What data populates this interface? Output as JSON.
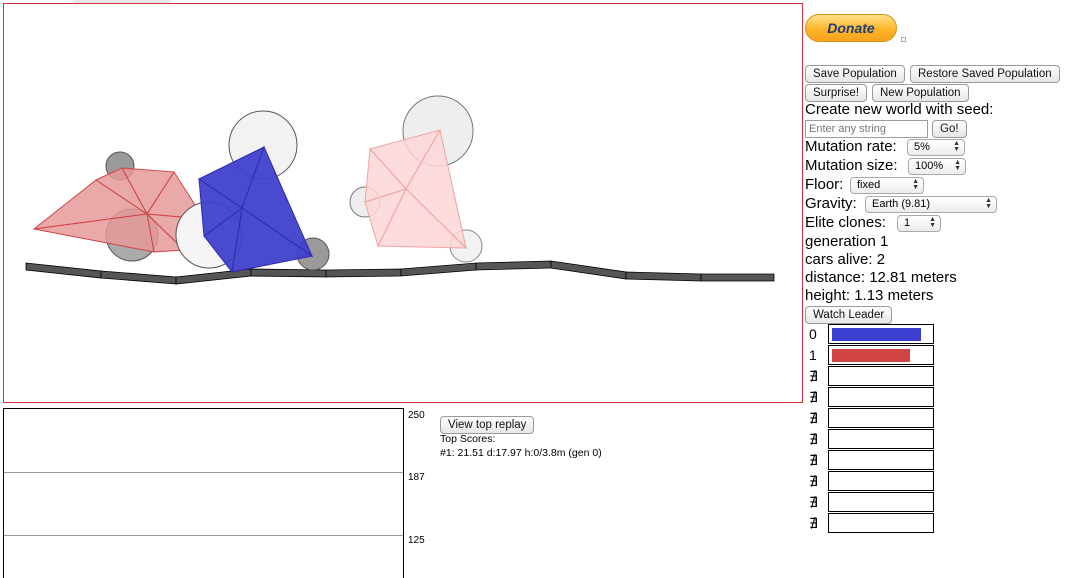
{
  "donate": {
    "label": "Donate"
  },
  "buttons": {
    "save_population": "Save Population",
    "restore_population": "Restore Saved Population",
    "surprise": "Surprise!",
    "new_population": "New Population",
    "go": "Go!",
    "watch_leader": "Watch Leader",
    "view_top_replay": "View top replay"
  },
  "seed": {
    "label": "Create new world with seed:",
    "placeholder": "Enter any string"
  },
  "settings": {
    "mutation_rate": {
      "label": "Mutation rate:",
      "value": "5%"
    },
    "mutation_size": {
      "label": "Mutation size:",
      "value": "100%"
    },
    "floor": {
      "label": "Floor:",
      "value": "fixed"
    },
    "gravity": {
      "label": "Gravity:",
      "value": "Earth (9.81)"
    },
    "elite_clones": {
      "label": "Elite clones:",
      "value": "1"
    }
  },
  "stats": {
    "generation": "generation 1",
    "cars_alive": "cars alive: 2",
    "distance": "distance: 12.81 meters",
    "height": "height: 1.13 meters"
  },
  "health_bars": [
    {
      "label": "0",
      "fill": 0.89,
      "color": "#3b3fd0"
    },
    {
      "label": "1",
      "fill": 0.78,
      "color": "#d24444"
    },
    {
      "label": "∄",
      "fill": 0
    },
    {
      "label": "∄",
      "fill": 0
    },
    {
      "label": "∄",
      "fill": 0
    },
    {
      "label": "∄",
      "fill": 0
    },
    {
      "label": "∄",
      "fill": 0
    },
    {
      "label": "∄",
      "fill": 0
    },
    {
      "label": "∄",
      "fill": 0
    },
    {
      "label": "∄",
      "fill": 0
    }
  ],
  "graph": {
    "ticks": [
      "250",
      "187",
      "125"
    ]
  },
  "top_scores": {
    "title": "Top Scores:",
    "entries": [
      "#1: 21.51 d:17.97 h:0/3.8m (gen 0)"
    ]
  },
  "colors": {
    "canvas_border": "#d8333a",
    "car_blue": "#3b3fd0",
    "car_red": "#d24444",
    "car_pink": "#f5b0b0"
  }
}
